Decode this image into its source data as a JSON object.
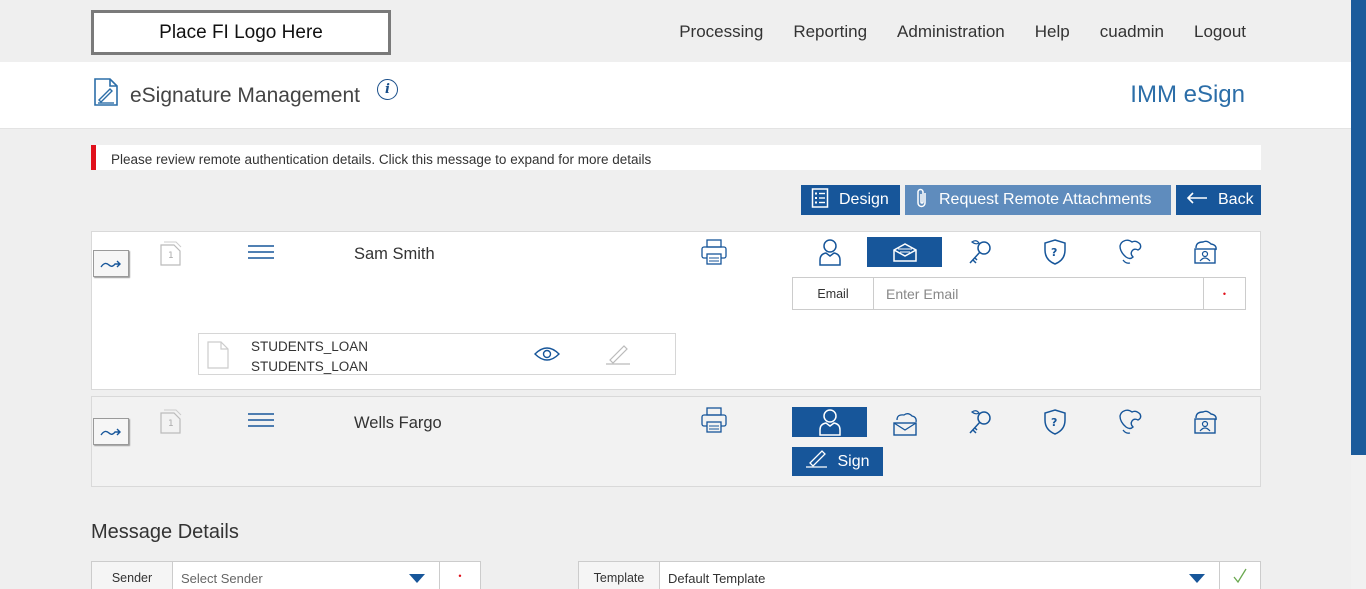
{
  "topbar": {
    "logo_text": "Place FI Logo Here",
    "nav": [
      "Processing",
      "Reporting",
      "Administration",
      "Help",
      "cuadmin",
      "Logout"
    ]
  },
  "header": {
    "title": "eSignature Management",
    "info_glyph": "i",
    "brand": "IMM eSign"
  },
  "alert": {
    "message": "Please review remote authentication details. Click this message to expand for more details",
    "color": "#e0101b"
  },
  "actions": {
    "design_label": "Design",
    "request_label": "Request Remote Attachments",
    "back_label": "Back"
  },
  "signers": [
    {
      "name": "Sam Smith",
      "active_auth": "email-auth",
      "email_label": "Email",
      "email_placeholder": "Enter Email",
      "required_marker": "•",
      "documents": [
        "STUDENTS_LOAN",
        "STUDENTS_LOAN"
      ]
    },
    {
      "name": "Wells Fargo",
      "active_auth": "in-person-auth",
      "sign_label": "Sign"
    }
  ],
  "auth_icons": [
    "in-person-icon",
    "email-icon",
    "kba-key-icon",
    "question-shield-icon",
    "phone-icon",
    "id-card-icon"
  ],
  "message_details": {
    "title": "Message Details",
    "sender_label": "Sender",
    "sender_placeholder": "Select Sender",
    "sender_required": "•",
    "template_label": "Template",
    "template_value": "Default Template"
  },
  "colors": {
    "primary": "#17569a",
    "primary_light": "#5f8cbd",
    "brand_text": "#2c6ea8",
    "alert": "#e0101b",
    "success_check": "#6aa84f"
  }
}
